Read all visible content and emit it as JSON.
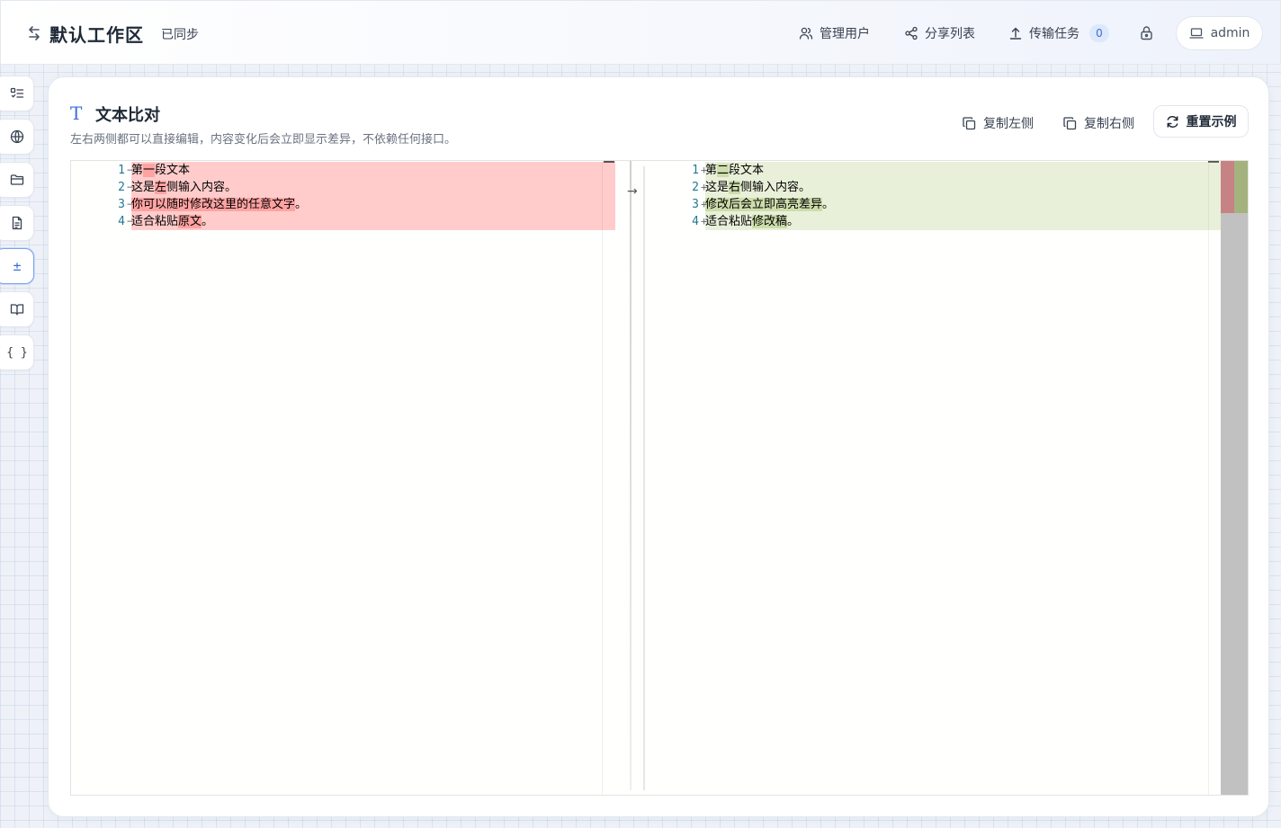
{
  "header": {
    "workspace_title": "默认工作区",
    "sync_status": "已同步",
    "manage_users": "管理用户",
    "share_list": "分享列表",
    "transfer_tasks": "传输任务",
    "transfer_count": "0",
    "user": "admin"
  },
  "sidebar": {
    "items": [
      {
        "icon": "list-check-icon"
      },
      {
        "icon": "globe-icon"
      },
      {
        "icon": "folder-icon"
      },
      {
        "icon": "document-icon"
      },
      {
        "icon": "plus-minus-icon",
        "label": "±",
        "active": true
      },
      {
        "icon": "book-icon"
      },
      {
        "icon": "braces-icon",
        "label": "{ }"
      }
    ]
  },
  "card": {
    "title": "文本比对",
    "subtitle": "左右两侧都可以直接编辑，内容变化后会立即显示差异，不依赖任何接口。",
    "copy_left": "复制左侧",
    "copy_right": "复制右侧",
    "reset_example": "重置示例"
  },
  "diff": {
    "left_lines": [
      {
        "num": "1",
        "mark": "−",
        "pre": "第",
        "changed": "一",
        "post": "段文本"
      },
      {
        "num": "2",
        "mark": "−",
        "pre": "这是",
        "changed": "左",
        "post": "侧输入内容。"
      },
      {
        "num": "3",
        "mark": "−",
        "pre": "",
        "changed": "你可以随时修改这里的任意文字",
        "post": "。"
      },
      {
        "num": "4",
        "mark": "−",
        "pre": "适合粘贴",
        "changed": "原文",
        "post": "。"
      }
    ],
    "right_lines": [
      {
        "num": "1",
        "mark": "+",
        "pre": "第",
        "changed": "二",
        "post": "段文本"
      },
      {
        "num": "2",
        "mark": "+",
        "pre": "这是",
        "changed": "右",
        "post": "侧输入内容。"
      },
      {
        "num": "3",
        "mark": "+",
        "pre": "",
        "changed": "修改后会立即高亮差异",
        "post": "。"
      },
      {
        "num": "4",
        "mark": "+",
        "pre": "适合粘贴",
        "changed": "修改稿",
        "post": "。"
      }
    ],
    "colors": {
      "deleted": "#ffcccc",
      "inserted": "#e9f0d8",
      "overview_deleted": "#c78383",
      "overview_inserted": "#a4b37e"
    }
  }
}
